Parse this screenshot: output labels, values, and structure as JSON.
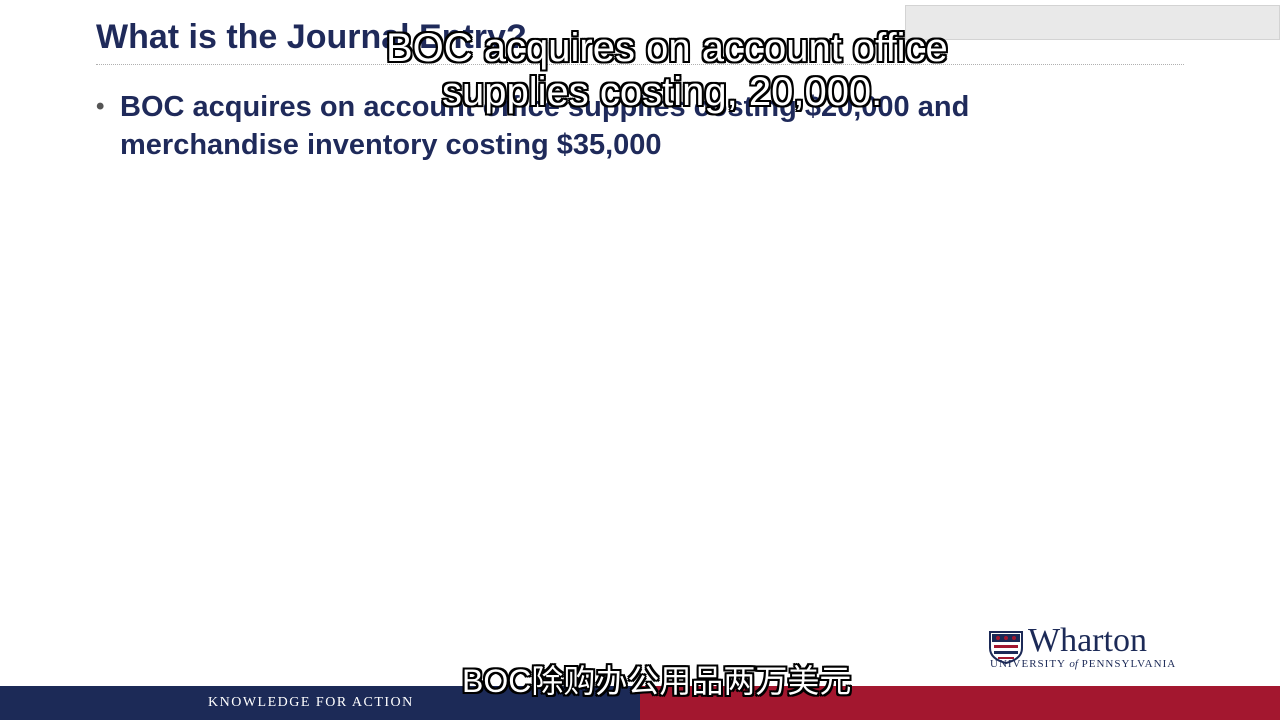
{
  "slide": {
    "title": "What is the Journal Entry?",
    "bullets": [
      "BOC acquires on account office supplies costing $20,000 and merchandise inventory costing $35,000"
    ]
  },
  "captions": {
    "top_line_1": "BOC acquires on account office",
    "top_line_2": "supplies costing, 20,000.",
    "bottom": "BOC除购办公用品两万美元"
  },
  "footer": {
    "tagline": "KNOWLEDGE FOR ACTION",
    "colors": {
      "left": "#1c2a57",
      "right": "#a3172f"
    }
  },
  "logo": {
    "icon": "penn-shield-icon",
    "wordmark": "Wharton",
    "sub_prefix": "UNIVERSITY",
    "sub_of": "of",
    "sub_suffix": "PENNSYLVANIA"
  },
  "colors": {
    "title": "#1f2a5a",
    "text": "#1f2a5a"
  }
}
